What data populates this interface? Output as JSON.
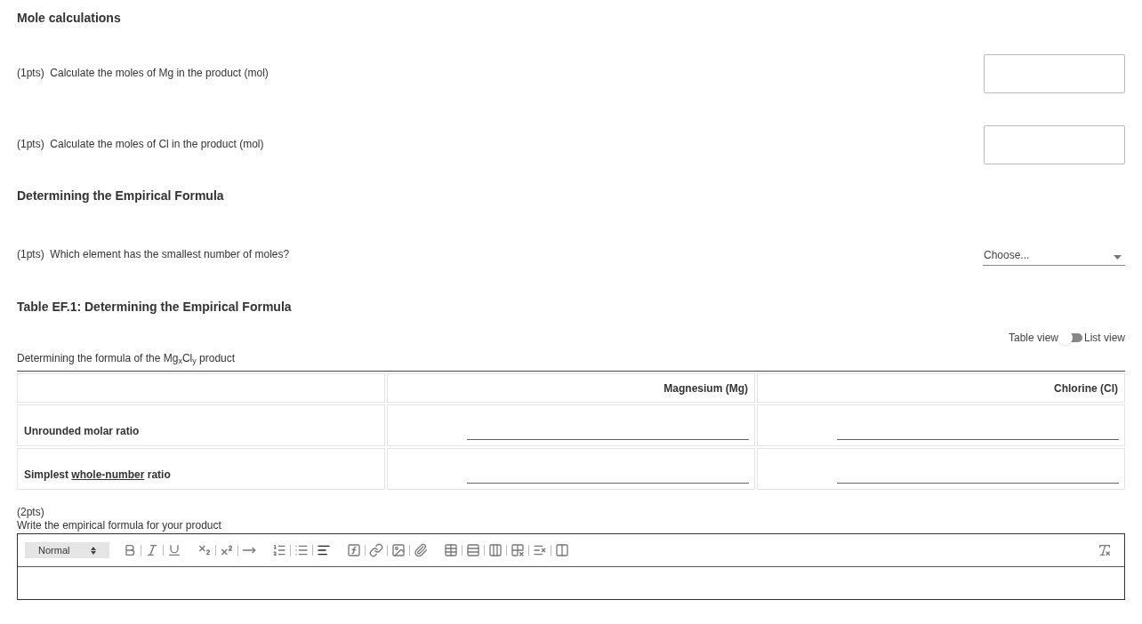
{
  "sections": [
    {
      "kind": "heading",
      "title": "Mole calculations"
    },
    {
      "kind": "text_question",
      "points": "(1pts)",
      "prompt": "Calculate the moles of Mg in the product (mol)"
    },
    {
      "kind": "text_question",
      "points": "(1pts)",
      "prompt": "Calculate the moles of Cl in the product (mol)"
    },
    {
      "kind": "heading",
      "title": "Determining the Empirical Formula"
    },
    {
      "kind": "select_question",
      "points": "(1pts)",
      "prompt": "Which element has the smallest number of moles?",
      "placeholder": "Choose..."
    }
  ],
  "table_section": {
    "title": "Table EF.1: Determining the Empirical Formula",
    "toggle": {
      "left_label": "Table view",
      "right_label": "List view",
      "on": false
    },
    "caption": "Determining the formula of the Mg$_{x}$Cl$_{y}$ product",
    "columns": [
      "Magnesium (Mg)",
      "Chlorine (Cl)"
    ],
    "rows": [
      {
        "label": [
          {
            "text": "Unrounded molar ratio",
            "underline": false
          }
        ]
      },
      {
        "label": [
          {
            "text": "Simplest ",
            "underline": false
          },
          {
            "text": "whole-number",
            "underline": true
          },
          {
            "text": " ratio",
            "underline": false
          }
        ]
      }
    ]
  },
  "essay": {
    "points": "(2pts)",
    "prompt": "Write the empirical formula for your product",
    "format_select": "Normal"
  }
}
